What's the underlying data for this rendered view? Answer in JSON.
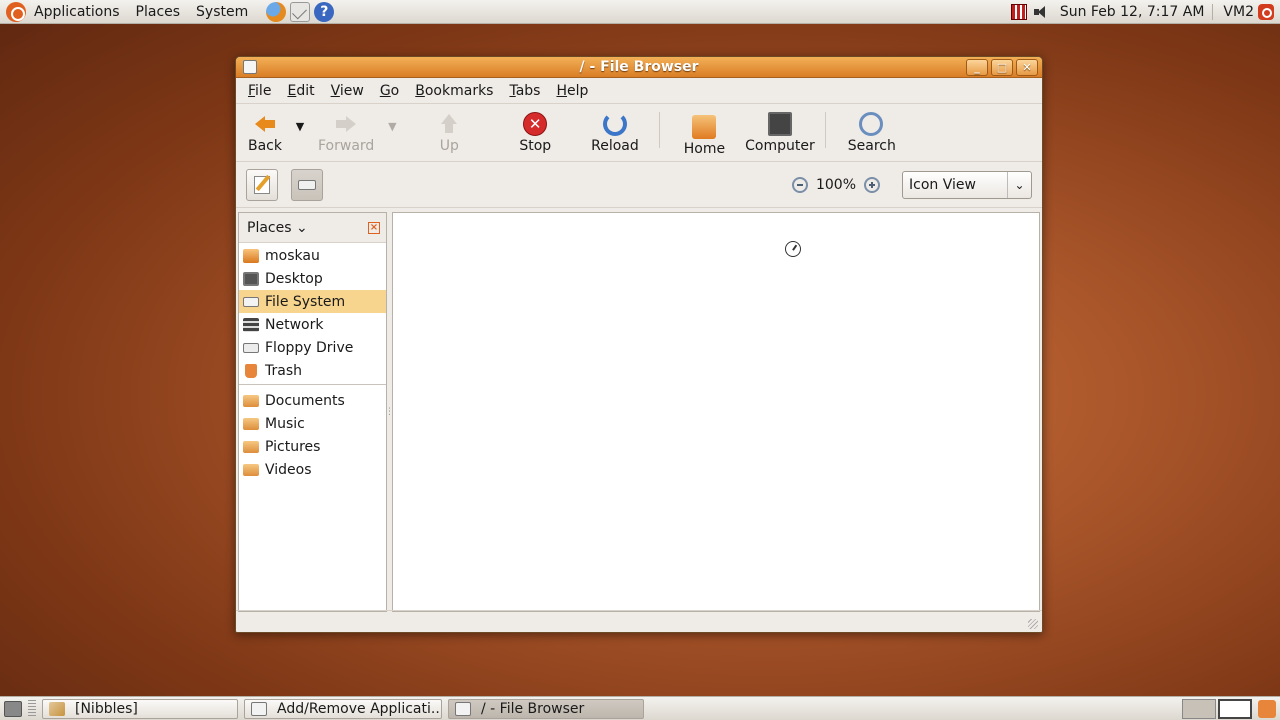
{
  "top_panel": {
    "menus": [
      "Applications",
      "Places",
      "System"
    ],
    "clock": "Sun Feb 12,  7:17 AM",
    "user": "VM2"
  },
  "window": {
    "title": "/ - File Browser",
    "wm_buttons": {
      "minimize": "_",
      "maximize": "□",
      "close": "✕"
    },
    "menubar": [
      "File",
      "Edit",
      "View",
      "Go",
      "Bookmarks",
      "Tabs",
      "Help"
    ],
    "toolbar": {
      "back": "Back",
      "forward": "Forward",
      "up": "Up",
      "stop": "Stop",
      "reload": "Reload",
      "home": "Home",
      "computer": "Computer",
      "search": "Search"
    },
    "location_bar": {
      "zoom": "100%",
      "view_mode": "Icon View"
    },
    "sidebar": {
      "title": "Places",
      "places": [
        {
          "label": "moskau",
          "icon": "home-folder-icon"
        },
        {
          "label": "Desktop",
          "icon": "desktop-icon"
        },
        {
          "label": "File System",
          "icon": "drive-icon",
          "selected": true
        },
        {
          "label": "Network",
          "icon": "network-icon"
        },
        {
          "label": "Floppy Drive",
          "icon": "floppy-icon"
        },
        {
          "label": "Trash",
          "icon": "trash-icon"
        }
      ],
      "bookmarks": [
        {
          "label": "Documents",
          "icon": "folder-icon"
        },
        {
          "label": "Music",
          "icon": "folder-icon"
        },
        {
          "label": "Pictures",
          "icon": "folder-icon"
        },
        {
          "label": "Videos",
          "icon": "folder-icon"
        }
      ]
    }
  },
  "taskbar": {
    "tasks": [
      {
        "label": "[Nibbles]",
        "active": false
      },
      {
        "label": "Add/Remove Applicati...",
        "active": false
      },
      {
        "label": "/ - File Browser",
        "active": true
      }
    ]
  }
}
